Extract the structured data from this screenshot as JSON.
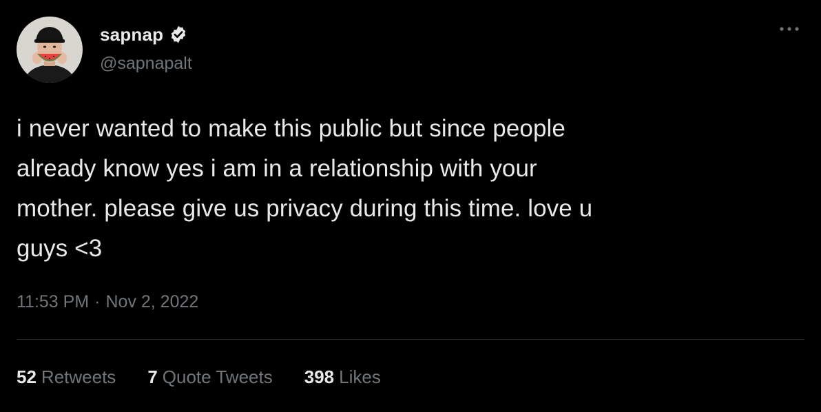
{
  "author": {
    "display_name": "sapnap",
    "handle": "@sapnapalt",
    "verified": true,
    "avatar_icon": "profile-photo-avatar"
  },
  "tweet": {
    "text": "i never wanted to make this public but since people\nalready know yes i am in a relationship with your\nmother. please give us privacy during this time. love u\nguys <3",
    "time": "11:53 PM",
    "separator": "·",
    "date": "Nov 2, 2022"
  },
  "stats": {
    "retweets_count": "52",
    "retweets_label": "Retweets",
    "quotes_count": "7",
    "quotes_label": "Quote Tweets",
    "likes_count": "398",
    "likes_label": "Likes"
  },
  "colors": {
    "background": "#000000",
    "primary_text": "#e7e9ea",
    "secondary_text": "#71767b",
    "divider": "#2f3336"
  },
  "icons": {
    "verified": "verified-badge-icon",
    "more": "more-options-icon"
  }
}
